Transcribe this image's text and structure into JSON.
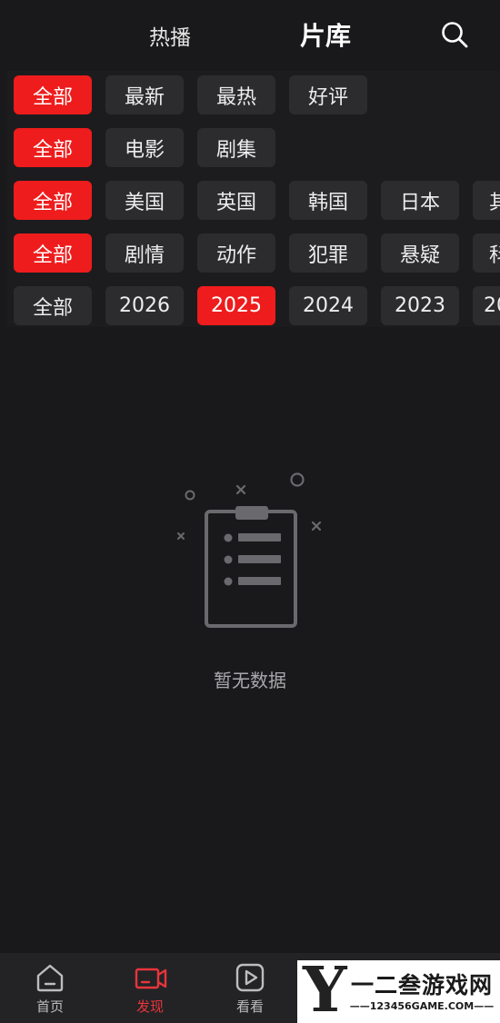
{
  "header": {
    "tab_hot": "热播",
    "tab_library": "片库",
    "search_icon": "search-icon"
  },
  "filters": {
    "sort": [
      "全部",
      "最新",
      "最热",
      "好评"
    ],
    "type": [
      "全部",
      "电影",
      "剧集"
    ],
    "region": [
      "全部",
      "美国",
      "英国",
      "韩国",
      "日本",
      "其"
    ],
    "genre": [
      "全部",
      "剧情",
      "动作",
      "犯罪",
      "悬疑",
      "科"
    ],
    "year": [
      "全部",
      "2026",
      "2025",
      "2024",
      "2023",
      "20"
    ],
    "selected": {
      "sort": "全部",
      "type": "全部",
      "region": "全部",
      "genre": "全部",
      "year": "2025"
    }
  },
  "empty_state": {
    "icon": "clipboard-list-icon",
    "text": "暂无数据"
  },
  "bottom_nav": [
    {
      "label": "首页",
      "icon": "home-icon",
      "active": false
    },
    {
      "label": "发现",
      "icon": "video-camera-icon",
      "active": true
    },
    {
      "label": "看看",
      "icon": "play-icon",
      "active": false
    }
  ],
  "watermark": {
    "logo_letter": "Y",
    "title": "一二叁游戏网",
    "site": "——123456GAME.COM——"
  },
  "colors": {
    "background": "#19191b",
    "chip": "#2c2c2f",
    "accent": "#ee1c1c",
    "nav_active": "#e8353a"
  }
}
